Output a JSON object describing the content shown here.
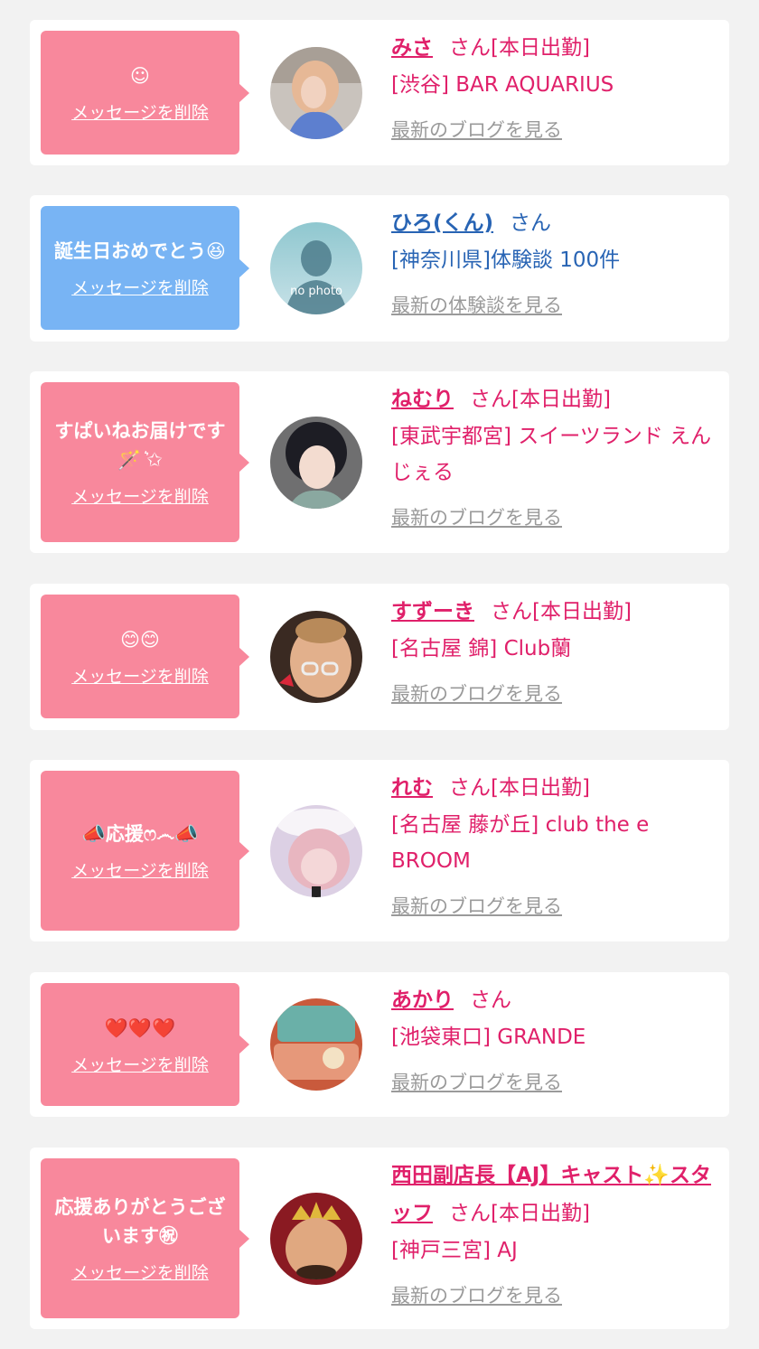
{
  "colors": {
    "pink_bubble": "#f8889c",
    "blue_bubble": "#78b4f4",
    "pink_text": "#e0206a",
    "blue_text": "#2864b4",
    "link_gray": "#9a9a9a"
  },
  "common": {
    "delete_label": "メッセージを削除"
  },
  "items": [
    {
      "message": "☺",
      "name": "みさ",
      "suffix": "さん[本日出勤]",
      "shop": "[渋谷] BAR AQUARIUS",
      "link": "最新のブログを見る",
      "theme": "pink"
    },
    {
      "message": "誕生日おめでとう😆",
      "name": "ひろ(くん)",
      "suffix": "さん",
      "shop": "[神奈川県]体験談 100件",
      "link": "最新の体験談を見る",
      "theme": "blue",
      "avatar_text": "no photo"
    },
    {
      "message": "すぱいねお届けです🪄 ͛✩",
      "name": "ねむり",
      "suffix": "さん[本日出勤]",
      "shop": "[東武宇都宮] スイーツランド えんじぇる",
      "link": "最新のブログを見る",
      "theme": "pink"
    },
    {
      "message": "😊😊",
      "name": "すずーき",
      "suffix": "さん[本日出勤]",
      "shop": "[名古屋 錦] Club蘭",
      "link": "最新のブログを見る",
      "theme": "pink"
    },
    {
      "message": "📣応援ෆ෴📣",
      "name": "れむ",
      "suffix": "さん[本日出勤]",
      "shop": "[名古屋 藤が丘] club the e BROOM",
      "link": "最新のブログを見る",
      "theme": "pink"
    },
    {
      "message": "❤️❤️❤️",
      "name": "あかり",
      "suffix": "さん",
      "shop": "[池袋東口] GRANDE",
      "link": "最新のブログを見る",
      "theme": "pink"
    },
    {
      "message": "応援ありがとうございます㊗",
      "name": "西田副店長【AJ】キャスト✨スタッフ",
      "suffix": "さん[本日出勤]",
      "shop": "[神戸三宮] AJ",
      "link": "最新のブログを見る",
      "theme": "pink"
    }
  ]
}
